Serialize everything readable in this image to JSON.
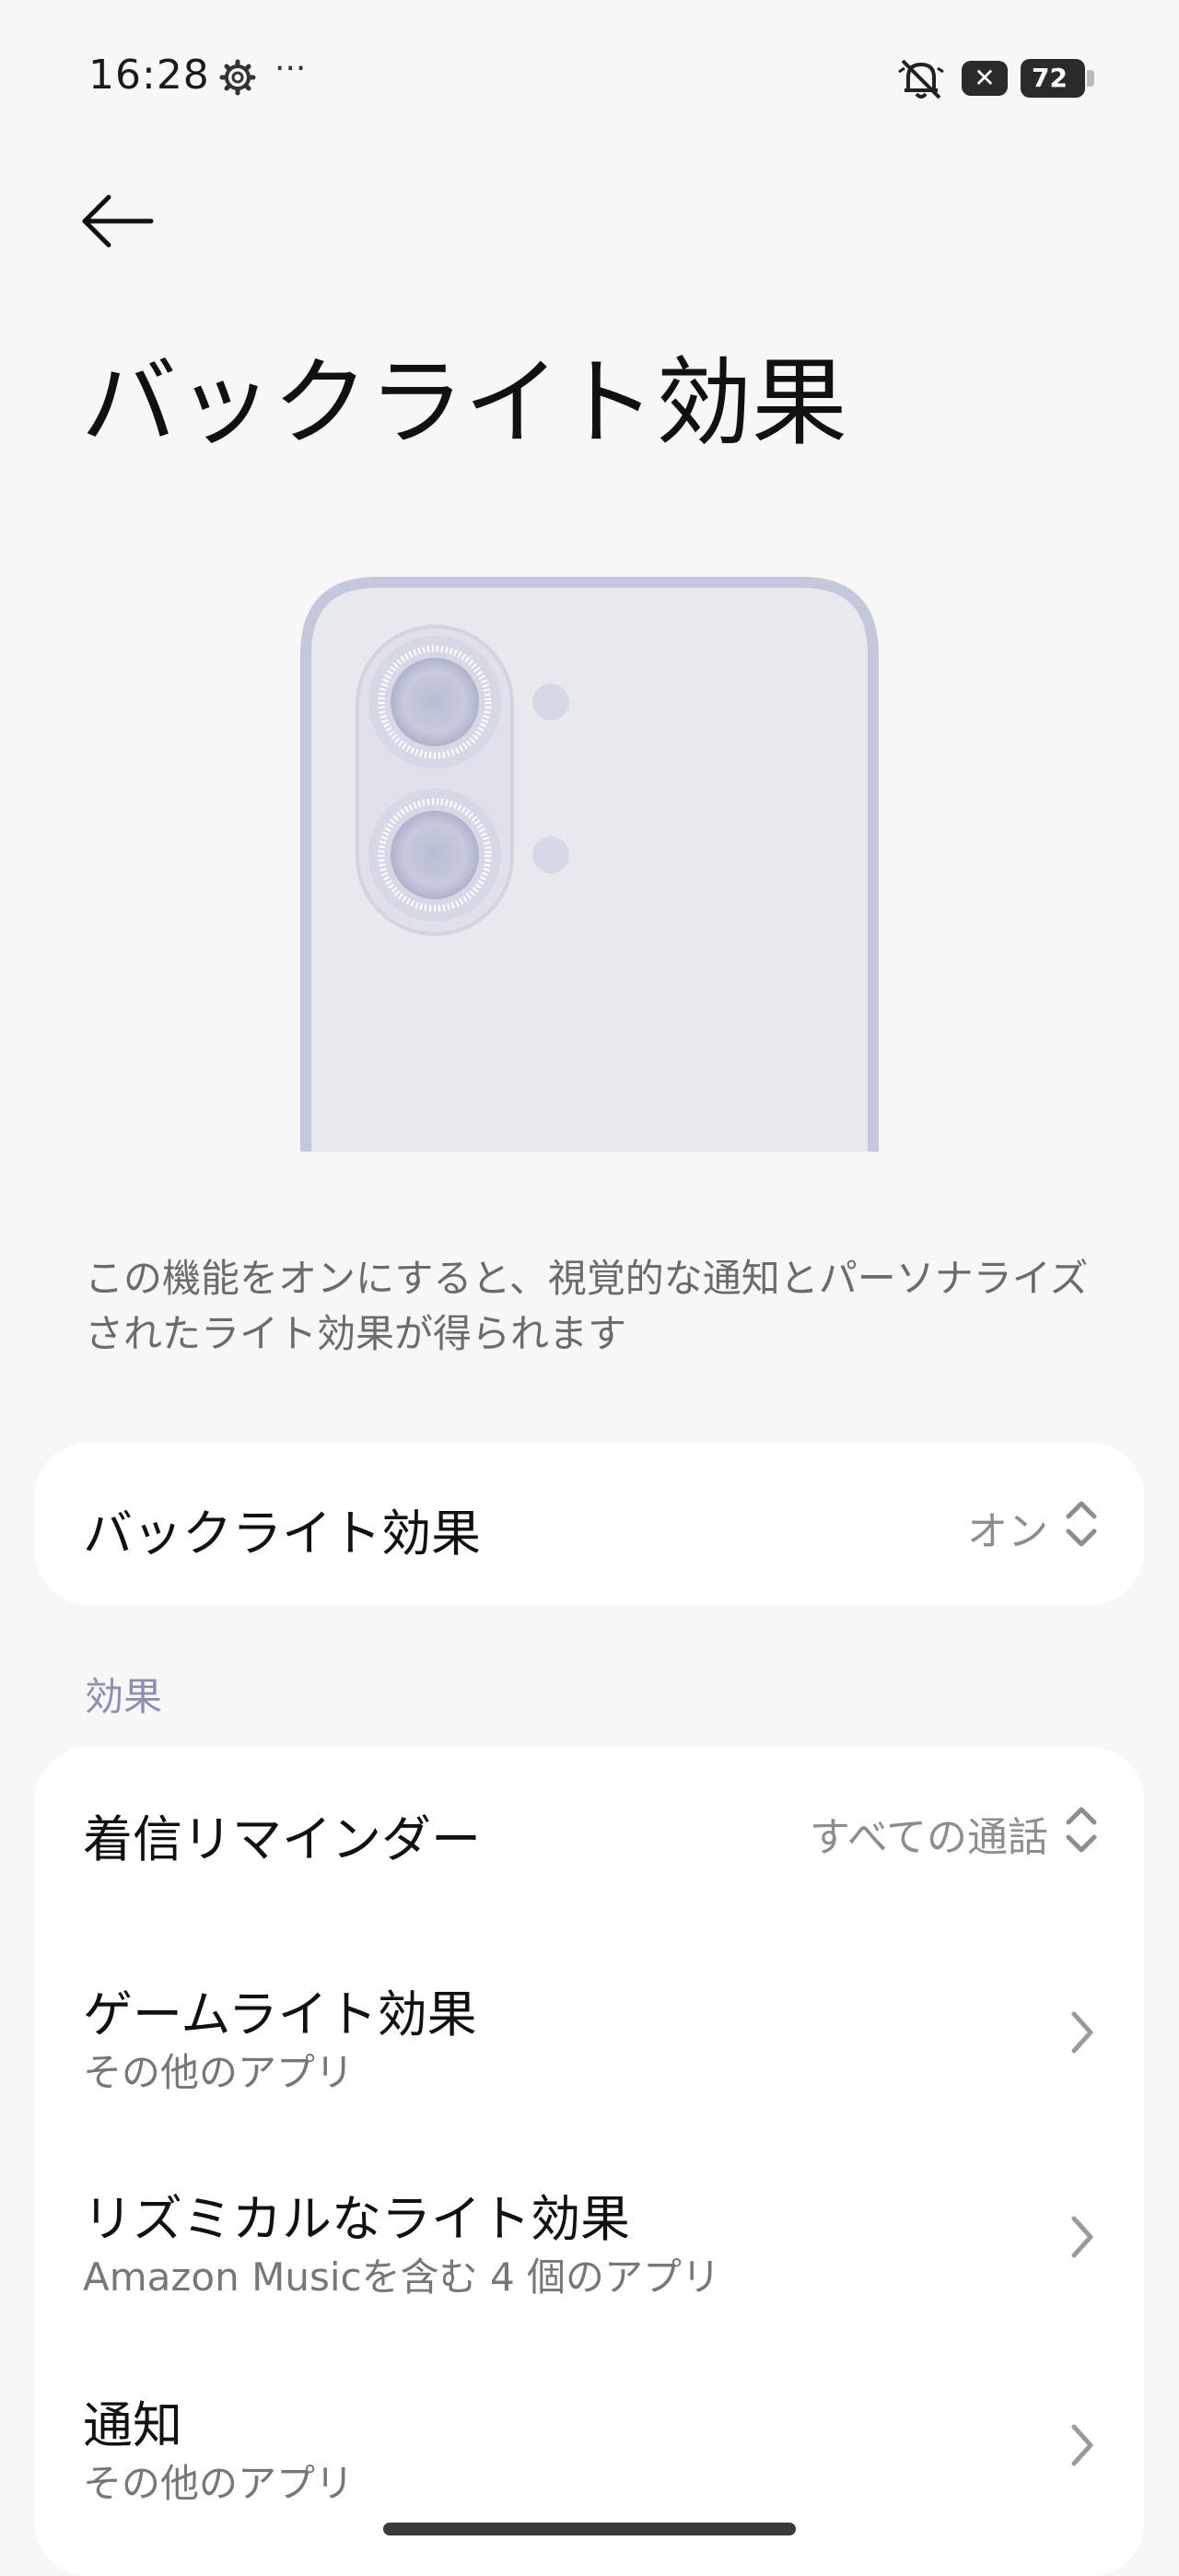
{
  "status_bar": {
    "time": "16:28",
    "more": "···",
    "xbox_glyph": "✕",
    "battery": "72"
  },
  "header": {
    "title": "バックライト効果"
  },
  "description": "この機能をオンにすると、視覚的な通知とパーソナライズされたライト効果が得られます",
  "main_toggle": {
    "label": "バックライト効果",
    "value": "オン"
  },
  "effects_section": {
    "header": "効果",
    "items": [
      {
        "title": "着信リマインダー",
        "value": "すべての通話"
      },
      {
        "title": "ゲームライト効果",
        "subtitle": "その他のアプリ"
      },
      {
        "title": "リズミカルなライト効果",
        "subtitle": "Amazon Musicを含む 4 個のアプリ"
      },
      {
        "title": "通知",
        "subtitle": "その他のアプリ"
      }
    ]
  },
  "icons": {
    "back": "back-arrow-icon",
    "gear": "gear-icon",
    "bell_off": "bell-off-icon",
    "updown": "updown-chevron-icon",
    "chevron": "chevron-right-icon"
  },
  "colors": {
    "background": "#f7f7f7",
    "card": "#ffffff",
    "section_header": "#8b90b0",
    "secondary_text": "#8d8d8d",
    "phone_frame": "#c4c8dc",
    "phone_body": "#e8e9ee"
  }
}
